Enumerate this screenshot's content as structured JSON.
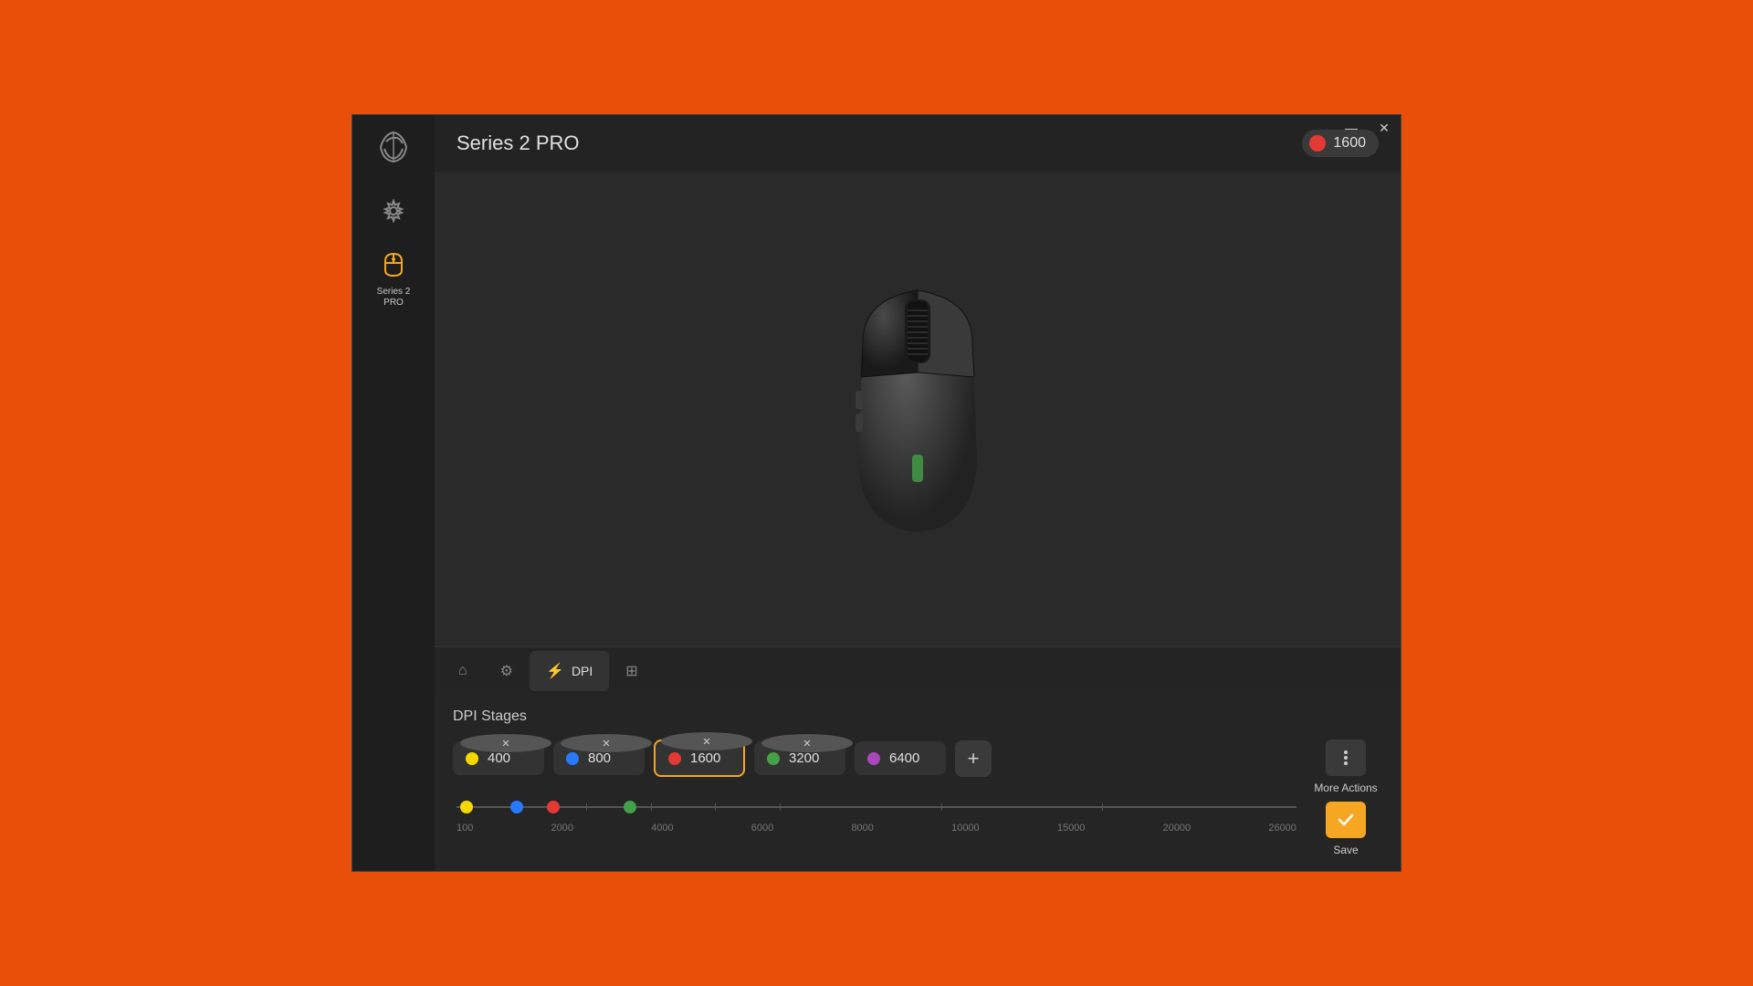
{
  "window": {
    "minimize_label": "—",
    "close_label": "✕"
  },
  "sidebar": {
    "logo_icon": "≋",
    "items": [
      {
        "id": "settings",
        "icon": "⚙",
        "label": "",
        "active": false
      },
      {
        "id": "device",
        "icon": "🖱",
        "label": "Series 2\nPRO",
        "active": true
      }
    ]
  },
  "device": {
    "title": "Series 2 PRO",
    "dpi_badge": {
      "color": "#E53935",
      "value": "1600"
    }
  },
  "tabs": [
    {
      "id": "home",
      "icon": "⌂",
      "label": "",
      "active": false
    },
    {
      "id": "performance",
      "icon": "⚙",
      "label": "",
      "active": false
    },
    {
      "id": "dpi",
      "icon": "⚡",
      "label": "DPI",
      "active": true
    },
    {
      "id": "layout",
      "icon": "⊞",
      "label": "",
      "active": false
    }
  ],
  "dpi_panel": {
    "header": "DPI Stages",
    "stages": [
      {
        "id": 1,
        "color": "#F5D800",
        "value": "400",
        "active": false
      },
      {
        "id": 2,
        "color": "#2979FF",
        "value": "800",
        "active": false
      },
      {
        "id": 3,
        "color": "#E53935",
        "value": "1600",
        "active": true
      },
      {
        "id": 4,
        "color": "#43A047",
        "value": "3200",
        "active": false
      },
      {
        "id": 5,
        "color": "#AB47BC",
        "value": "6400",
        "active": false
      }
    ],
    "add_label": "+",
    "more_actions_label": "More Actions",
    "save_label": "Save"
  },
  "slider": {
    "min": 100,
    "max": 26000,
    "labels": [
      "100",
      "2000",
      "4000",
      "6000",
      "8000",
      "10000",
      "15000",
      "20000",
      "26000"
    ],
    "dots": [
      {
        "color": "#F5D800",
        "pct": 1.2
      },
      {
        "color": "#2979FF",
        "pct": 7.2
      },
      {
        "color": "#E53935",
        "pct": 11.5
      },
      {
        "color": "#43A047",
        "pct": 20.6
      }
    ]
  },
  "colors": {
    "accent": "#F5A623",
    "active_stage_border": "#F5A623",
    "red": "#E53935",
    "yellow": "#F5D800",
    "blue": "#2979FF",
    "green": "#43A047",
    "purple": "#AB47BC"
  }
}
